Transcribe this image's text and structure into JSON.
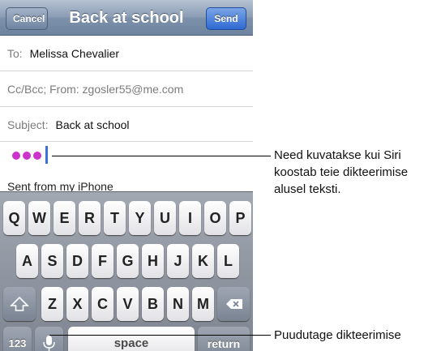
{
  "navbar": {
    "cancel_label": "Cancel",
    "title": "Back at school",
    "send_label": "Send"
  },
  "fields": {
    "to_label": "To:",
    "to_value": "Melissa Chevalier",
    "cc_text": "Cc/Bcc; From: zgosler55@me.com",
    "subject_label": "Subject:",
    "subject_value": "Back at school"
  },
  "body": {
    "signature": "Sent from my iPhone"
  },
  "keyboard": {
    "row1": [
      "Q",
      "W",
      "E",
      "R",
      "T",
      "Y",
      "U",
      "I",
      "O",
      "P"
    ],
    "row2": [
      "A",
      "S",
      "D",
      "F",
      "G",
      "H",
      "J",
      "K",
      "L"
    ],
    "row3": [
      "Z",
      "X",
      "C",
      "V",
      "B",
      "N",
      "M"
    ],
    "numbers_label": "123",
    "space_label": "space",
    "return_label": "return",
    "icons": [
      "shift-icon",
      "delete-icon",
      "microphone-icon"
    ]
  },
  "callouts": {
    "dots_note_lines": [
      "Need kuvatakse kui Siri",
      "koostab teie dikteerimise",
      "alusel teksti."
    ],
    "mic_note": "Puudutage dikteerimise"
  },
  "colors": {
    "dots": "#cc33cc",
    "cursor": "#3d6fd8",
    "send_button": "#2f6ad2"
  }
}
